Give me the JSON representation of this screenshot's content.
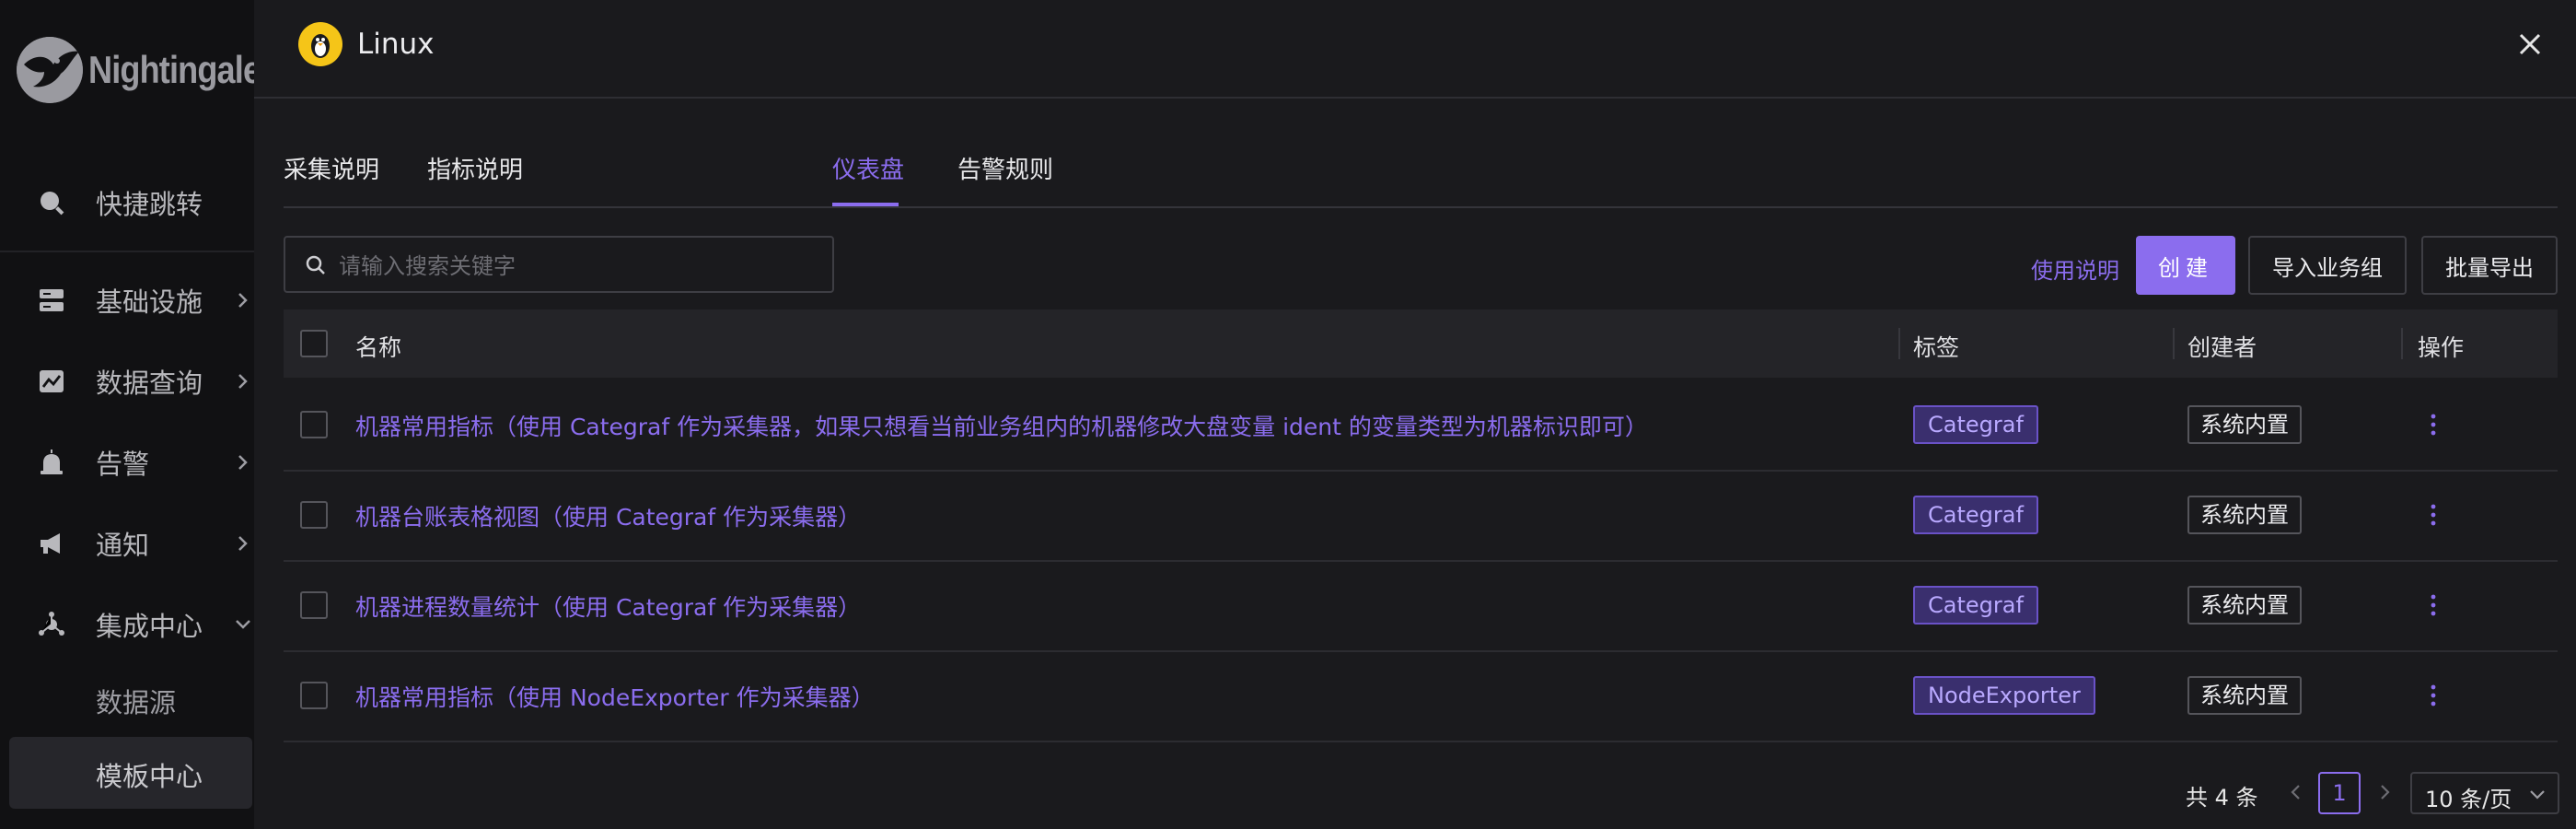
{
  "app": {
    "logo_text": "Nightingale"
  },
  "sidebar": {
    "items": [
      {
        "label": "快捷跳转",
        "icon": "search-icon"
      },
      {
        "label": "基础设施",
        "icon": "server-icon"
      },
      {
        "label": "数据查询",
        "icon": "chart-icon"
      },
      {
        "label": "告警",
        "icon": "alarm-icon"
      },
      {
        "label": "通知",
        "icon": "megaphone-icon"
      },
      {
        "label": "集成中心",
        "icon": "integration-icon"
      }
    ],
    "sub_items": [
      {
        "label": "数据源"
      },
      {
        "label": "模板中心"
      }
    ]
  },
  "drawer": {
    "title": "Linux",
    "tabs": [
      {
        "label": "采集说明"
      },
      {
        "label": "指标说明"
      },
      {
        "label": "仪表盘"
      },
      {
        "label": "告警规则"
      }
    ],
    "active_tab": "仪表盘",
    "search": {
      "placeholder": "请输入搜索关键字",
      "value": ""
    },
    "help_link": "使用说明",
    "create_button": "创建",
    "import_button": "导入业务组",
    "export_button": "批量导出",
    "table": {
      "headers": {
        "name": "名称",
        "tags": "标签",
        "creator": "创建者",
        "actions": "操作"
      },
      "rows": [
        {
          "name": "机器常用指标（使用 Categraf 作为采集器，如果只想看当前业务组内的机器修改大盘变量 ident 的变量类型为机器标识即可）",
          "tag": "Categraf",
          "creator": "系统内置"
        },
        {
          "name": "机器台账表格视图（使用 Categraf 作为采集器）",
          "tag": "Categraf",
          "creator": "系统内置"
        },
        {
          "name": "机器进程数量统计（使用 Categraf 作为采集器）",
          "tag": "Categraf",
          "creator": "系统内置"
        },
        {
          "name": "机器常用指标（使用 NodeExporter 作为采集器）",
          "tag": "NodeExporter",
          "creator": "系统内置"
        }
      ]
    },
    "pagination": {
      "total_text": "共 4 条",
      "current_page": "1",
      "page_size": "10 条/页"
    }
  },
  "colors": {
    "accent": "#8b6dee",
    "background": "#1a1a1d",
    "sidebar": "#111113",
    "tag_bg": "#3a2f6e"
  }
}
